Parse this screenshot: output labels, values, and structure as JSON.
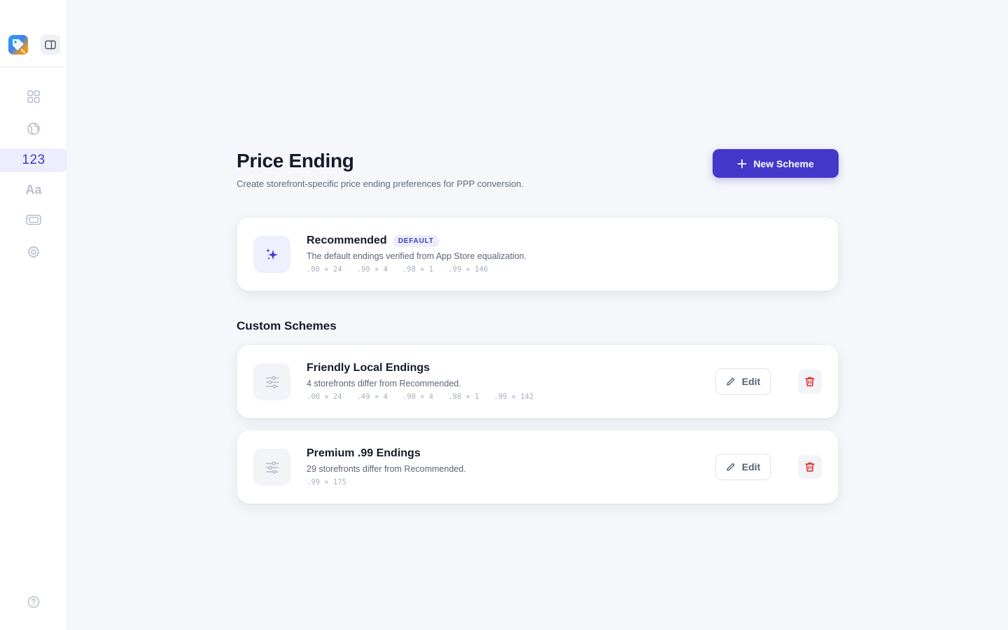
{
  "sidebar": {
    "logo_icon": "price-tag-app-icon",
    "toggle_icon": "sidebar-toggle-icon",
    "items": [
      {
        "id": "dashboard",
        "icon": "grid-icon",
        "label": ""
      },
      {
        "id": "globe",
        "icon": "globe-icon",
        "label": ""
      },
      {
        "id": "price-ending",
        "icon": "numbers-icon",
        "label": "123",
        "active": true
      },
      {
        "id": "typography",
        "icon": "text-icon",
        "label": "Aa"
      },
      {
        "id": "tickets",
        "icon": "ticket-icon",
        "label": ""
      },
      {
        "id": "settings",
        "icon": "gear-icon",
        "label": ""
      }
    ],
    "help_icon": "help-icon"
  },
  "header": {
    "title": "Price Ending",
    "subtitle": "Create storefront-specific price ending preferences for PPP conversion.",
    "new_button_label": "New Scheme"
  },
  "recommended": {
    "title": "Recommended",
    "badge": "DEFAULT",
    "description": "The default endings verified from App Store equalization.",
    "endings": [
      ".00 × 24",
      ".90 × 4",
      ".98 × 1",
      ".99 × 146"
    ]
  },
  "custom_section_title": "Custom Schemes",
  "schemes": [
    {
      "title": "Friendly Local Endings",
      "description": "4 storefronts differ from Recommended.",
      "endings": [
        ".00 × 24",
        ".49 × 4",
        ".90 × 4",
        ".98 × 1",
        ".99 × 142"
      ],
      "edit_label": "Edit"
    },
    {
      "title": "Premium .99 Endings",
      "description": "29 storefronts differ from Recommended.",
      "endings": [
        ".99 × 175"
      ],
      "edit_label": "Edit"
    }
  ],
  "colors": {
    "accent": "#4338ca",
    "danger": "#dc2626",
    "background": "#f5f7fa"
  }
}
